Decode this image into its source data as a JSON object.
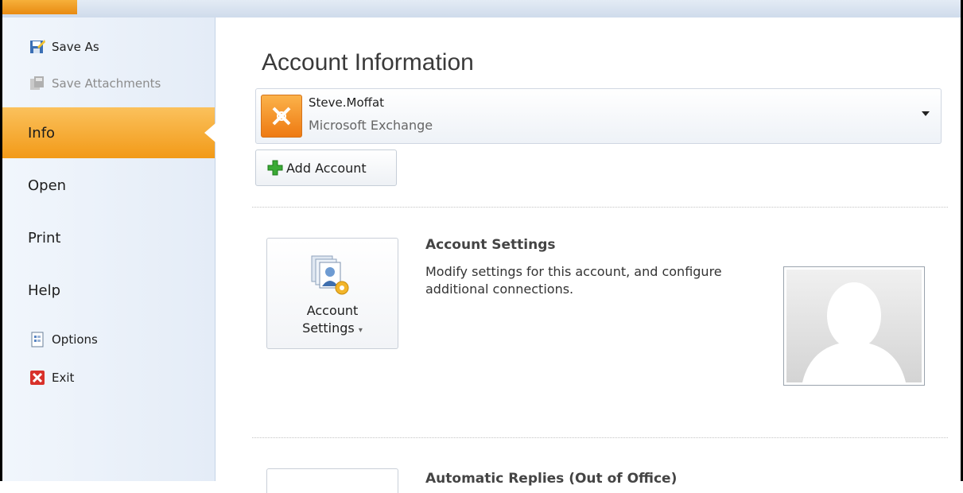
{
  "sidebar": {
    "items": [
      {
        "label": "Save As",
        "icon": "save-as-icon",
        "state": "normal"
      },
      {
        "label": "Save Attachments",
        "icon": "save-attachments-icon",
        "state": "disabled"
      },
      {
        "label": "Info",
        "state": "active"
      },
      {
        "label": "Open",
        "state": "normal"
      },
      {
        "label": "Print",
        "state": "normal"
      },
      {
        "label": "Help",
        "state": "normal"
      },
      {
        "label": "Options",
        "icon": "options-icon",
        "state": "normal"
      },
      {
        "label": "Exit",
        "icon": "exit-icon",
        "state": "normal"
      }
    ]
  },
  "main": {
    "title": "Account Information",
    "account": {
      "name": "Steve.Moffat",
      "type": "Microsoft Exchange",
      "icon": "exchange-icon"
    },
    "add_account_label": "Add Account",
    "account_settings": {
      "button_label_line1": "Account",
      "button_label_line2": "Settings",
      "heading": "Account Settings",
      "description": "Modify settings for this account, and configure additional connections."
    },
    "auto_replies_heading": "Automatic Replies (Out of Office)"
  },
  "colors": {
    "accent": "#f29a18",
    "sidebar_bg": "#e4ecf7"
  }
}
